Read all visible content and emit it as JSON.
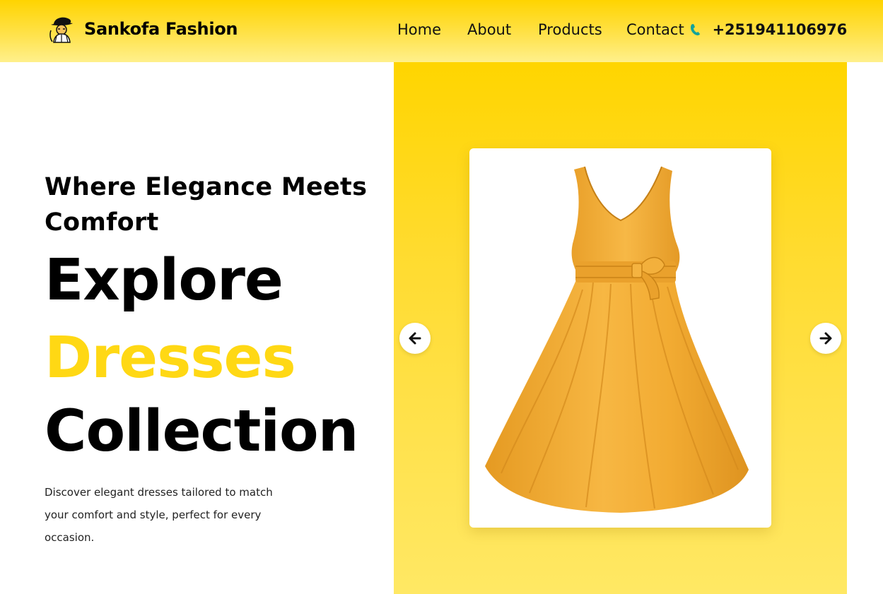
{
  "brand": {
    "name": "Sankofa Fashion",
    "logo_icon": "hat-figure-logo"
  },
  "nav": {
    "items": [
      {
        "label": "Home"
      },
      {
        "label": "About"
      },
      {
        "label": "Products"
      },
      {
        "label": "Contact"
      }
    ]
  },
  "contact": {
    "phone_icon": "phone-icon",
    "phone": "+251941106976"
  },
  "hero": {
    "tagline": "Where Elegance Meets Comfort",
    "headline_line1": "Explore",
    "headline_line2": "Dresses",
    "headline_line3": "Collection",
    "description": "Discover elegant dresses tailored to match your comfort and style, perfect for every occasion."
  },
  "carousel": {
    "prev_icon": "arrow-left-icon",
    "next_icon": "arrow-right-icon",
    "product_image": "orange-sleeveless-dress"
  },
  "colors": {
    "accent": "#ffd814",
    "header_top": "#ffd400",
    "panel": "#ffdb2e",
    "dress": "#f2ac33",
    "phone_icon": "#14a39a"
  }
}
